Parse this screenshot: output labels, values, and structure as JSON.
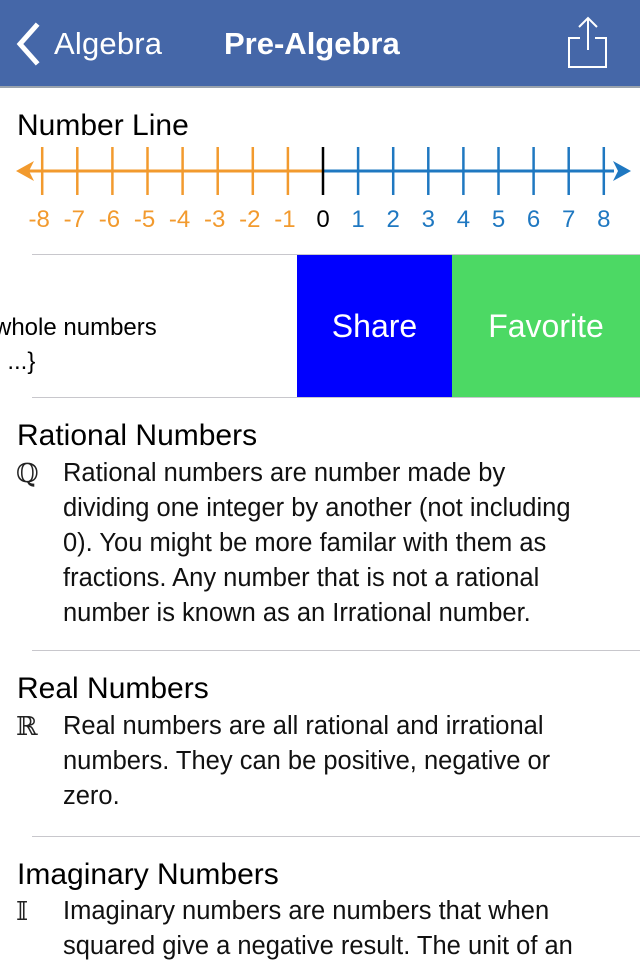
{
  "navbar": {
    "back_label": "Algebra",
    "title": "Pre-Algebra",
    "background": "#4567a8",
    "icons": {
      "back": "chevron-left-icon",
      "share": "share-icon"
    }
  },
  "number_line": {
    "title": "Number Line",
    "negative_labels": [
      "-8",
      "-7",
      "-6",
      "-5",
      "-4",
      "-3",
      "-2",
      "-1"
    ],
    "zero_label": "0",
    "positive_labels": [
      "1",
      "2",
      "3",
      "4",
      "5",
      "6",
      "7",
      "8"
    ],
    "negative_color": "#f29a2e",
    "zero_color": "#000000",
    "positive_color": "#1f78c1"
  },
  "swiped_row": {
    "text_line1": "whole numbers",
    "text_line2": ", ...}",
    "share_label": "Share",
    "favorite_label": "Favorite",
    "share_color": "#0000ff",
    "favorite_color": "#4cd964"
  },
  "entries": [
    {
      "title": "Rational Numbers",
      "symbol": "ℚ",
      "lines": [
        "Rational numbers are number made by",
        "dividing one integer by another (not including",
        "0). You might be more familar with them as",
        "fractions. Any number that is not a rational",
        "number is known as an Irrational number."
      ]
    },
    {
      "title": "Real Numbers",
      "symbol": "ℝ",
      "lines": [
        "Real numbers are all rational and irrational",
        "numbers. They can be positive, negative or",
        "zero."
      ]
    },
    {
      "title": "Imaginary Numbers",
      "symbol": "𝕀",
      "lines": [
        "Imaginary numbers are numbers that when",
        "squared give a negative result. The unit of an"
      ]
    }
  ]
}
